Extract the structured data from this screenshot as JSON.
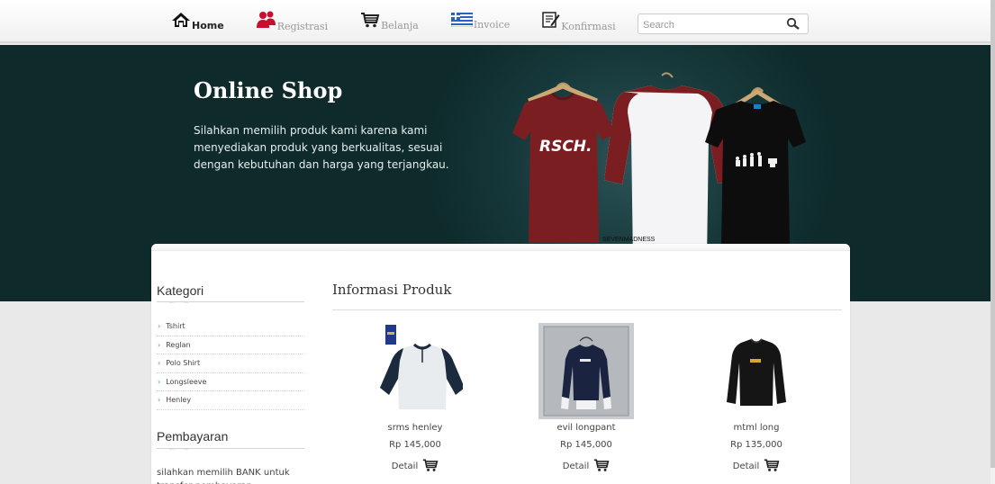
{
  "nav": {
    "items": [
      {
        "label": "Home",
        "icon": "home-icon"
      },
      {
        "label": "Registrasi",
        "icon": "users-icon"
      },
      {
        "label": "Belanja",
        "icon": "cart-icon"
      },
      {
        "label": "Invoice",
        "icon": "flag-icon"
      },
      {
        "label": "Konfirmasi",
        "icon": "edit-icon"
      }
    ],
    "active": "Home",
    "search_placeholder": "Search"
  },
  "banner": {
    "title": "Online Shop",
    "text": "Silahkan memilih produk kami karena kami menyediakan produk yang berkualitas, sesuai dengan kebutuhan dan harga yang terjangkau.",
    "shirt_print_1": "RSCH.",
    "shirt_label": "SEVENMADNESS"
  },
  "sidebar": {
    "kategori_title": "Kategori",
    "categories": [
      "Tshirt",
      "Reglan",
      "Polo Shirt",
      "Longsleeve",
      "Henley"
    ],
    "pembayaran_title": "Pembayaran",
    "pembayaran_text": "silahkan memilih BANK untuk transfer pembayaran pembelian"
  },
  "main": {
    "title": "Informasi Produk",
    "detail_label": "Detail",
    "products": [
      {
        "name": "srms henley",
        "price": "Rp 145,000"
      },
      {
        "name": "evil longpant",
        "price": "Rp 145,000"
      },
      {
        "name": "mtml long",
        "price": "Rp 135,000"
      }
    ]
  },
  "colors": {
    "banner_bg": "#17393b",
    "link_blue": "#3a8fc8",
    "maroon_shirt": "#7a1e22"
  }
}
